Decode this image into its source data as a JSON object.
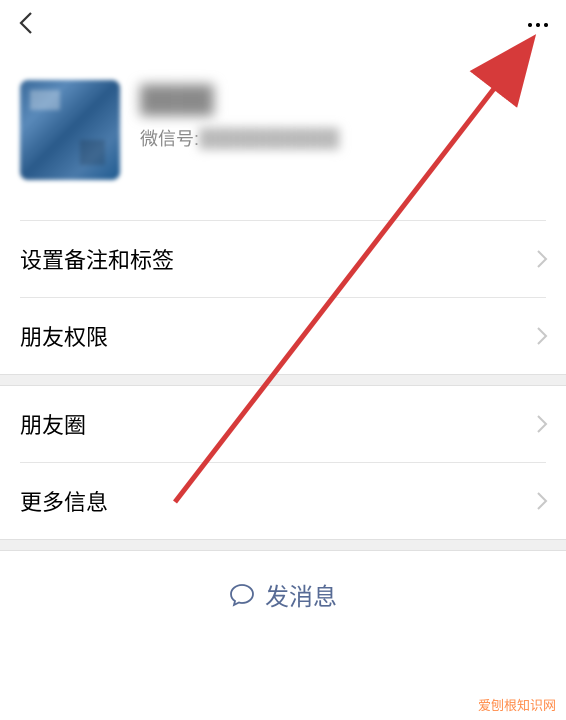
{
  "header": {
    "back_icon": "chevron-left-icon",
    "more_icon": "more-icon"
  },
  "profile": {
    "display_name": "████",
    "wechat_label": "微信号: ",
    "wechat_id": "███████████"
  },
  "items": {
    "remark_tag": "设置备注和标签",
    "friend_perm": "朋友权限",
    "moments": "朋友圈",
    "more_info": "更多信息"
  },
  "action": {
    "send_message": "发消息"
  },
  "watermark": "爱刨根知识网",
  "colors": {
    "link": "#576b95",
    "arrow": "#d63a3a"
  }
}
